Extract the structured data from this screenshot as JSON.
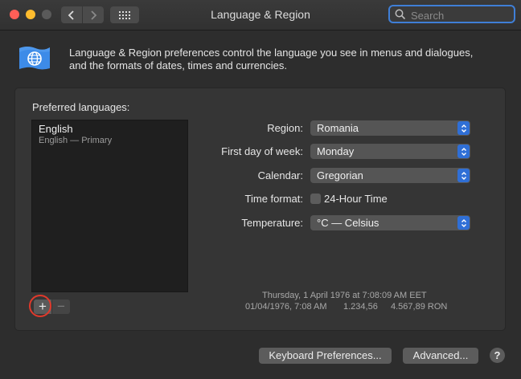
{
  "window": {
    "title": "Language & Region",
    "search_placeholder": "Search"
  },
  "description": {
    "line1": "Language & Region preferences control the language you see in menus and dialogues,",
    "line2": "and the formats of dates, times and currencies."
  },
  "preferred_languages": {
    "label": "Preferred languages:",
    "items": [
      {
        "name": "English",
        "sub": "English — Primary"
      }
    ],
    "add_label": "+",
    "remove_label": "−"
  },
  "settings": {
    "region": {
      "label": "Region:",
      "value": "Romania"
    },
    "first_day": {
      "label": "First day of week:",
      "value": "Monday"
    },
    "calendar": {
      "label": "Calendar:",
      "value": "Gregorian"
    },
    "time_format": {
      "label": "Time format:",
      "checkbox_label": "24-Hour Time"
    },
    "temperature": {
      "label": "Temperature:",
      "value": "°C — Celsius"
    }
  },
  "sample": {
    "full_date": "Thursday, 1 April 1976 at 7:08:09 AM EET",
    "short_date": "01/04/1976, 7:08 AM",
    "number": "1.234,56",
    "currency": "4.567,89 RON"
  },
  "buttons": {
    "keyboard": "Keyboard Preferences...",
    "advanced": "Advanced...",
    "help": "?"
  },
  "colors": {
    "accent": "#2f6fd6",
    "highlight_circle": "#e0392b"
  }
}
